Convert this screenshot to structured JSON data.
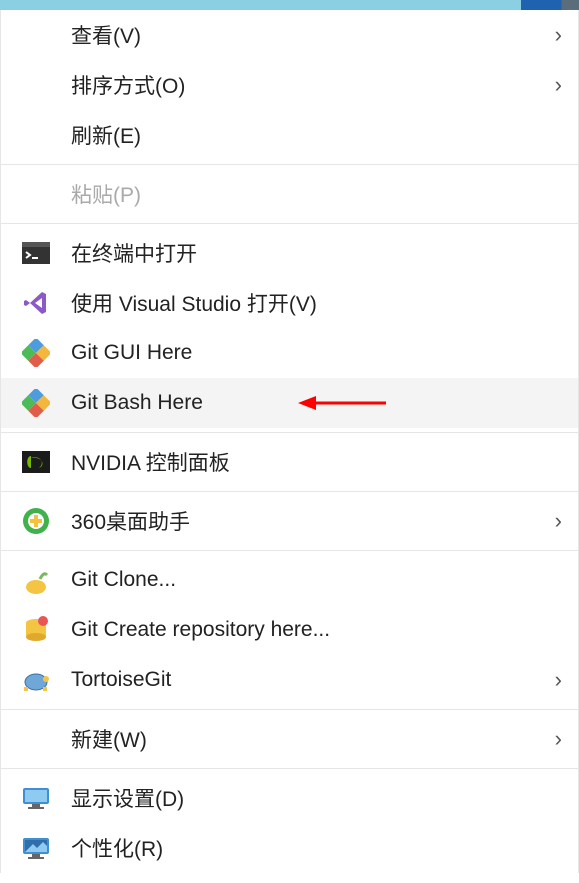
{
  "menu": {
    "view": {
      "label": "查看(V)",
      "submenu": true,
      "disabled": false
    },
    "sort": {
      "label": "排序方式(O)",
      "submenu": true,
      "disabled": false
    },
    "refresh": {
      "label": "刷新(E)",
      "submenu": false,
      "disabled": false
    },
    "paste": {
      "label": "粘贴(P)",
      "submenu": false,
      "disabled": true
    },
    "open_terminal": {
      "label": "在终端中打开",
      "submenu": false,
      "disabled": false
    },
    "open_vs": {
      "label": "使用 Visual Studio 打开(V)",
      "submenu": false,
      "disabled": false
    },
    "git_gui": {
      "label": "Git GUI Here",
      "submenu": false,
      "disabled": false
    },
    "git_bash": {
      "label": "Git Bash Here",
      "submenu": false,
      "disabled": false,
      "highlighted": true
    },
    "nvidia": {
      "label": "NVIDIA 控制面板",
      "submenu": false,
      "disabled": false
    },
    "desk360": {
      "label": "360桌面助手",
      "submenu": true,
      "disabled": false
    },
    "git_clone": {
      "label": "Git Clone...",
      "submenu": false,
      "disabled": false
    },
    "git_create_repo": {
      "label": "Git Create repository here...",
      "submenu": false,
      "disabled": false
    },
    "tortoisegit": {
      "label": "TortoiseGit",
      "submenu": true,
      "disabled": false
    },
    "new": {
      "label": "新建(W)",
      "submenu": true,
      "disabled": false
    },
    "display": {
      "label": "显示设置(D)",
      "submenu": false,
      "disabled": false
    },
    "personalize": {
      "label": "个性化(R)",
      "submenu": false,
      "disabled": false
    }
  },
  "annotation": {
    "arrow_color": "#ff0000",
    "target": "git_bash"
  }
}
